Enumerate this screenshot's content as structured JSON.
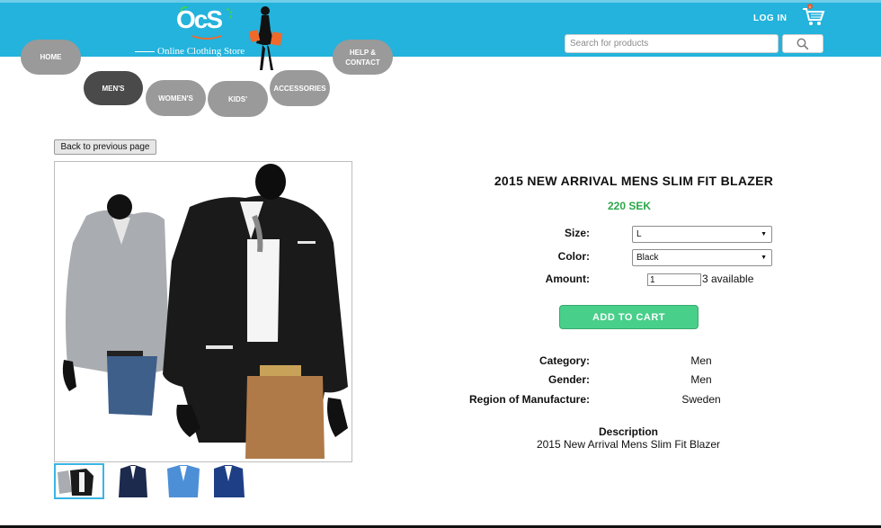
{
  "header": {
    "logo_mark": "OcS",
    "logo_text": "Online Clothing Store",
    "login_label": "LOG IN",
    "cart_count": "0",
    "search_placeholder": "Search for products"
  },
  "nav": {
    "home": "HOME",
    "help_line1": "HELP &",
    "help_line2": "CONTACT",
    "mens": "MEN'S",
    "womens": "WOMEN'S",
    "kids": "KIDS'",
    "accessories": "ACCESSORIES"
  },
  "back_label": "Back to previous page",
  "product": {
    "title": "2015 NEW ARRIVAL MENS SLIM FIT BLAZER",
    "price": "220 SEK",
    "size_label": "Size:",
    "size_value": "L",
    "color_label": "Color:",
    "color_value": "Black",
    "amount_label": "Amount:",
    "amount_value": "1",
    "available": "3 available",
    "add_to_cart": "ADD TO CART",
    "category_label": "Category:",
    "category_value": "Men",
    "gender_label": "Gender:",
    "gender_value": "Men",
    "region_label": "Region of Manufacture:",
    "region_value": "Sweden",
    "description_label": "Description",
    "description_text": "2015 New Arrival Mens Slim Fit Blazer"
  },
  "colors": {
    "header": "#23b3dc",
    "pill": "#9a9a9a",
    "pill_active": "#4a4a4a",
    "price": "#2ba84a",
    "cart_button": "#48cf8a"
  }
}
